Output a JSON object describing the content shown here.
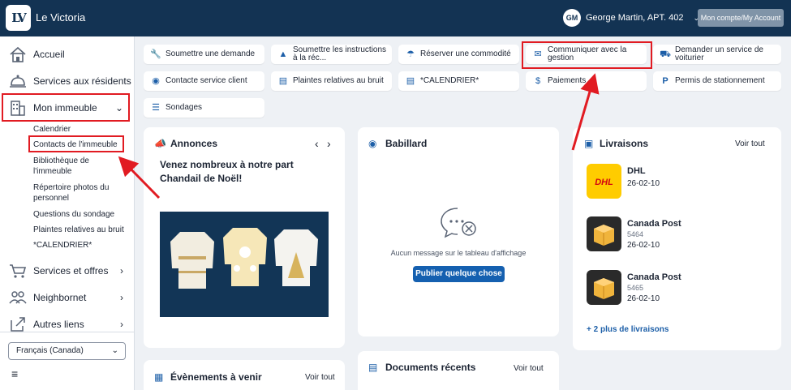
{
  "header": {
    "logo_text": "LV",
    "app_title": "Le Victoria",
    "user_initials": "GM",
    "user_name": "George Martin, APT. 402",
    "account_button": "Mon compte/My Account"
  },
  "sidebar": {
    "items": [
      {
        "label": "Accueil",
        "icon": "home-icon"
      },
      {
        "label": "Services aux résidents",
        "icon": "bell-icon"
      },
      {
        "label": "Mon immeuble",
        "icon": "building-icon"
      },
      {
        "label": "Services et offres",
        "icon": "cart-icon"
      },
      {
        "label": "Neighbornet",
        "icon": "people-icon"
      },
      {
        "label": "Autres liens",
        "icon": "external-link-icon"
      }
    ],
    "sub_items": [
      "Calendrier",
      "Contacts de l'immeuble",
      "Bibliothèque de l'immeuble",
      "Répertoire photos du personnel",
      "Questions du sondage",
      "Plaintes relatives au bruit",
      "*CALENDRIER*"
    ],
    "language": "Français (Canada)"
  },
  "quick_actions": [
    {
      "label": "Soumettre une demande",
      "icon": "wrench-icon"
    },
    {
      "label": "Soumettre les instructions à la réc...",
      "icon": "bell-desk-icon"
    },
    {
      "label": "Réserver une commodité",
      "icon": "umbrella-icon"
    },
    {
      "label": "Communiquer avec la gestion",
      "icon": "envelope-icon"
    },
    {
      "label": "Demander un service de voiturier",
      "icon": "car-icon"
    },
    {
      "label": "Contacte service client",
      "icon": "chat-icon"
    },
    {
      "label": "Plaintes relatives au bruit",
      "icon": "document-icon"
    },
    {
      "label": "*CALENDRIER*",
      "icon": "document-icon"
    },
    {
      "label": "Paiements",
      "icon": "dollar-icon"
    },
    {
      "label": "Permis de stationnement",
      "icon": "parking-icon"
    },
    {
      "label": "Sondages",
      "icon": "list-icon"
    }
  ],
  "annonces": {
    "title": "Annonces",
    "headline": "Venez nombreux à notre part Chandail de Noël!"
  },
  "babillard": {
    "title": "Babillard",
    "empty_message": "Aucun message sur le tableau d'affichage",
    "post_button": "Publier quelque chose"
  },
  "livraisons": {
    "title": "Livraisons",
    "see_all": "Voir tout",
    "items": [
      {
        "carrier": "DHL",
        "number": "",
        "date": "26-02-10"
      },
      {
        "carrier": "Canada Post",
        "number": "5464",
        "date": "26-02-10"
      },
      {
        "carrier": "Canada Post",
        "number": "5465",
        "date": "26-02-10"
      }
    ],
    "more": "+ 2 plus de livraisons"
  },
  "evenements": {
    "title": "Évènements à venir",
    "see_all": "Voir tout"
  },
  "documents": {
    "title": "Documents récents",
    "see_all": "Voir tout"
  },
  "colors": {
    "navy": "#133353",
    "accent": "#1d5fa8",
    "highlight": "#e11b22",
    "dhl_yellow": "#ffcc00"
  }
}
